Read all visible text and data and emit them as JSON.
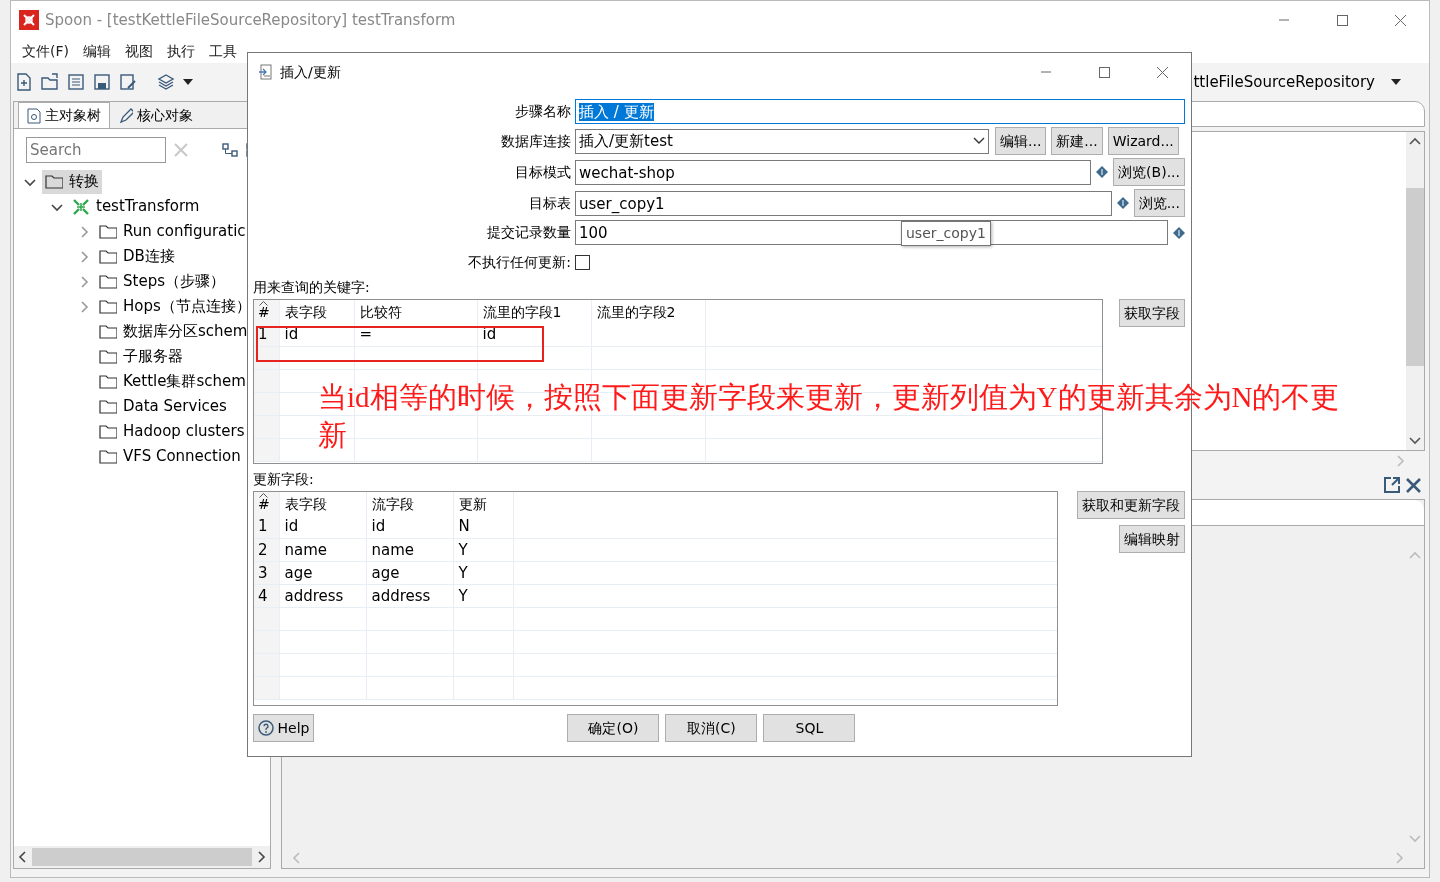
{
  "window": {
    "title": "Spoon - [testKettleFileSourceRepository] testTransform"
  },
  "menu": [
    "文件(F)",
    "编辑",
    "视图",
    "执行",
    "工具"
  ],
  "repository": {
    "value": "ttleFileSourceRepository"
  },
  "left_tabs": [
    {
      "label": "主对象树",
      "selected": true
    },
    {
      "label": "核心对象",
      "selected": false
    }
  ],
  "search": {
    "placeholder": "Search"
  },
  "tree": [
    {
      "label": "转换",
      "kind": "folder",
      "expanded": true,
      "selected": true,
      "children": [
        {
          "label": "testTransform",
          "kind": "transformation",
          "expanded": true,
          "selected": false,
          "children": [
            {
              "label": "Run configuratic",
              "kind": "folder",
              "expanded": false,
              "selected": false
            },
            {
              "label": "DB连接",
              "kind": "folder",
              "expanded": false,
              "selected": false
            },
            {
              "label": "Steps（步骤）",
              "kind": "folder",
              "expanded": false,
              "selected": false
            },
            {
              "label": "Hops（节点连接）",
              "kind": "folder",
              "expanded": false,
              "selected": false
            },
            {
              "label": "数据库分区schem",
              "kind": "folder",
              "selected": false
            },
            {
              "label": "子服务器",
              "kind": "folder",
              "selected": false
            },
            {
              "label": "Kettle集群schem",
              "kind": "folder",
              "selected": false
            },
            {
              "label": "Data Services",
              "kind": "folder",
              "selected": false
            },
            {
              "label": "Hadoop clusters",
              "kind": "folder",
              "selected": false
            },
            {
              "label": "VFS Connection",
              "kind": "folder",
              "selected": false
            }
          ]
        }
      ]
    }
  ],
  "dialog": {
    "title": "插入/更新",
    "fields": [
      {
        "kind": "text",
        "label": "步骤名称",
        "value": "插入 / 更新",
        "selected": true
      },
      {
        "kind": "dropdown",
        "label": "数据库连接",
        "value": "插入/更新test",
        "buttons": [
          "编辑...",
          "新建...",
          "Wizard..."
        ]
      },
      {
        "kind": "text",
        "label": "目标模式",
        "value": "wechat-shop",
        "selected": false,
        "variable": true,
        "buttons": [
          "浏览(B)..."
        ]
      },
      {
        "kind": "text",
        "label": "目标表",
        "value": "user_copy1",
        "selected": false,
        "variable": true,
        "buttons": [
          "浏览..."
        ]
      },
      {
        "kind": "text",
        "label": "提交记录数量",
        "value": "100",
        "selected": false,
        "variable": true
      },
      {
        "kind": "checkbox",
        "label": "不执行任何更新:",
        "checked": false
      }
    ],
    "tooltip": "user_copy1",
    "key_section": {
      "label": "用来查询的关键字:",
      "columns": [
        "#",
        "表字段",
        "比较符",
        "流里的字段1",
        "流里的字段2"
      ],
      "rows": [
        {
          "cells": [
            "1",
            "id",
            "=",
            "id"
          ],
          "highlighted": true
        }
      ],
      "button": "获取字段"
    },
    "note": "当id相等的时候，按照下面更新字段来更新，更新列值为Y的更新其余为N的不更新",
    "update_section": {
      "label": "更新字段:",
      "columns": [
        "#",
        "表字段",
        "流字段",
        "更新"
      ],
      "rows": [
        {
          "cells": [
            "1",
            "id",
            "id",
            "N"
          ]
        },
        {
          "cells": [
            "2",
            "name",
            "name",
            "Y"
          ]
        },
        {
          "cells": [
            "3",
            "age",
            "age",
            "Y"
          ]
        },
        {
          "cells": [
            "4",
            "address",
            "address",
            "Y"
          ]
        }
      ],
      "buttons": [
        "获取和更新字段",
        "编辑映射"
      ]
    },
    "help": "Help",
    "buttons": [
      "确定(O)",
      "取消(C)",
      "SQL"
    ]
  }
}
